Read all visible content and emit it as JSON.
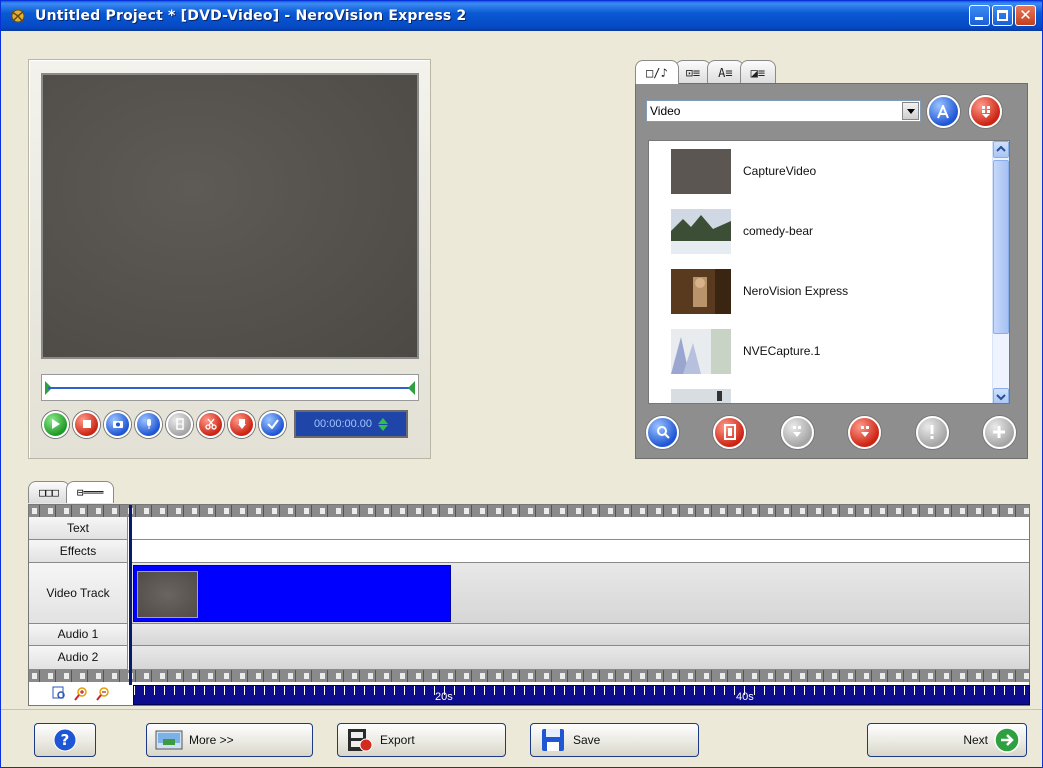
{
  "window": {
    "title": "Untitled Project * [DVD-Video] - NeroVision Express 2"
  },
  "preview": {
    "timecode": "00:00:00.00"
  },
  "library": {
    "tabs": [
      "□/♪",
      "⊡≡",
      "A≡",
      "◪≡"
    ],
    "category": "Video",
    "items": [
      {
        "name": "CaptureVideo"
      },
      {
        "name": "comedy-bear"
      },
      {
        "name": "NeroVision Express"
      },
      {
        "name": "NVECapture.1"
      }
    ]
  },
  "timeline": {
    "tabs": [
      "□□□",
      "⊟═══"
    ],
    "tracks": {
      "text": "Text",
      "effects": "Effects",
      "video": "Video Track",
      "audio1": "Audio 1",
      "audio2": "Audio 2"
    },
    "ruler_labels": [
      "20s",
      "40s"
    ]
  },
  "bottom": {
    "help_label": "?",
    "more_label": "More >>",
    "export_label": "Export",
    "save_label": "Save",
    "next_label": "Next"
  },
  "colors": {
    "clip": "#0000ff",
    "ruler": "#0c0c8c",
    "titlebar": "#0a5ad4"
  }
}
